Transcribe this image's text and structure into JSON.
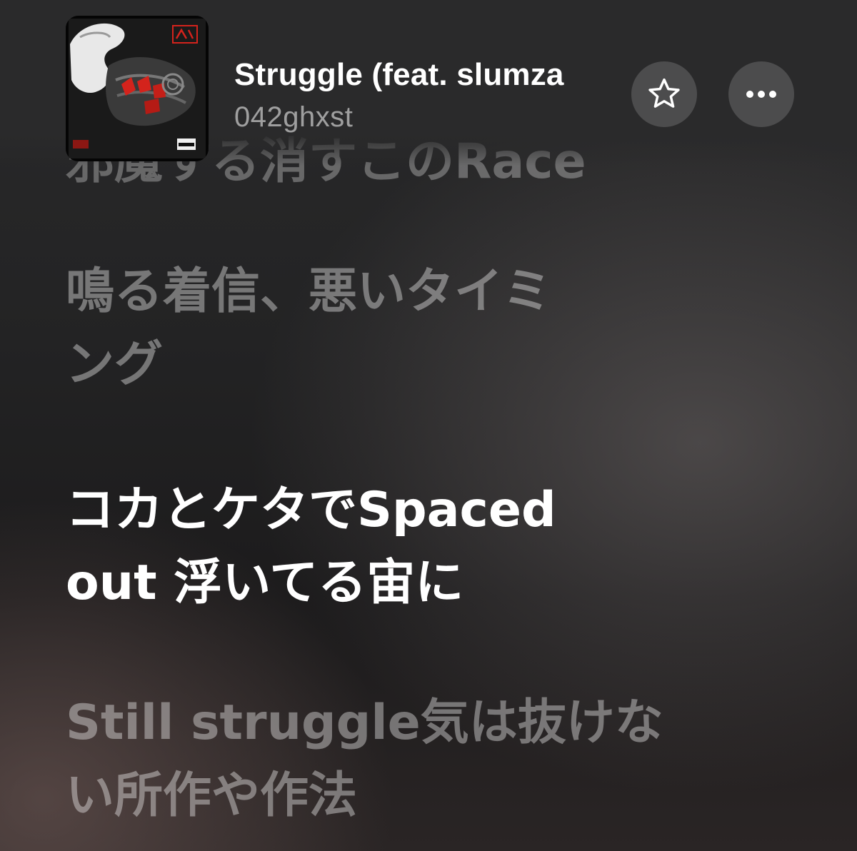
{
  "song": {
    "title": "Struggle (feat. slumza",
    "artist": "042ghxst"
  },
  "icons": {
    "favorite": "star-outline-icon",
    "more": "ellipsis-icon"
  },
  "lyrics": {
    "faded_top": "邪魔する消すこのRace",
    "past": "鳴る着信、悪いタイミ\nング",
    "current": "コカとケタでSpaced\nout 浮いてる宙に",
    "next": "Still struggle気は抜けな\nい所作や作法"
  },
  "colors": {
    "current_lyric": "#ffffff",
    "dim_lyric": "rgba(255,255,255,0.38)",
    "album_accent": "#d4231c"
  }
}
